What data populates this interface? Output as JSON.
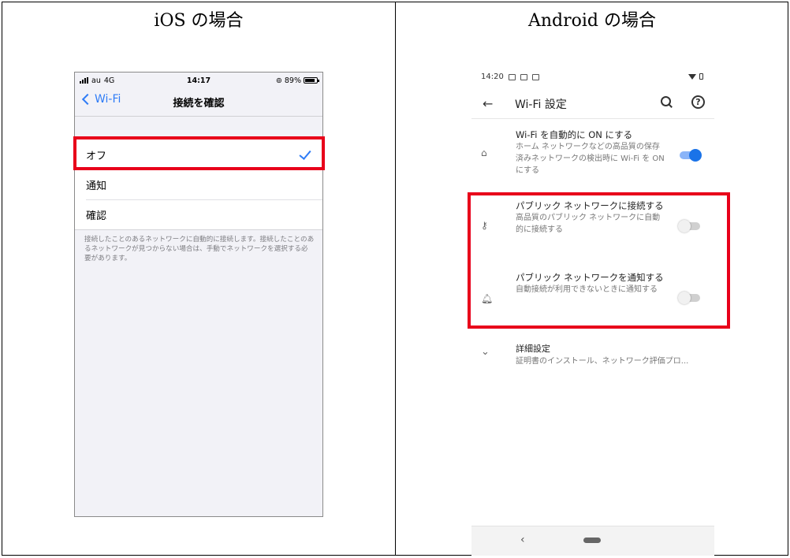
{
  "headers": {
    "ios": "iOS の場合",
    "android": "Android の場合"
  },
  "ios": {
    "status": {
      "carrier": "au",
      "network": "4G",
      "time": "14:17",
      "battery": "89%",
      "battery_level": 0.89
    },
    "nav": {
      "back_label": "Wi-Fi",
      "title": "接続を確認"
    },
    "options": [
      {
        "label": "オフ",
        "selected": true
      },
      {
        "label": "通知",
        "selected": false
      },
      {
        "label": "確認",
        "selected": false
      }
    ],
    "footnote": "接続したことのあるネットワークに自動的に接続します。接続したことのあるネットワークが見つからない場合は、手動でネットワークを選択する必要があります。",
    "accent_color": "#2f7cf6"
  },
  "android": {
    "status": {
      "time": "14:20"
    },
    "appbar": {
      "title": "Wi-Fi 設定"
    },
    "items": [
      {
        "title": "Wi-Fi を自動的に ON にする",
        "summary": "ホーム ネットワークなどの高品質の保存済みネットワークの検出時に Wi-Fi を ON にする",
        "toggle": true
      },
      {
        "title": "パブリック ネットワークに接続する",
        "summary": "高品質のパブリック ネットワークに自動的に接続する",
        "toggle": false
      },
      {
        "title": "パブリック ネットワークを通知する",
        "summary": "自動接続が利用できないときに通知する",
        "toggle": false
      }
    ],
    "advanced": {
      "title": "詳細設定",
      "summary": "証明書のインストール、ネットワーク評価プロ..."
    },
    "accent_color": "#1a73e8"
  },
  "highlight_color": "#e8001a"
}
